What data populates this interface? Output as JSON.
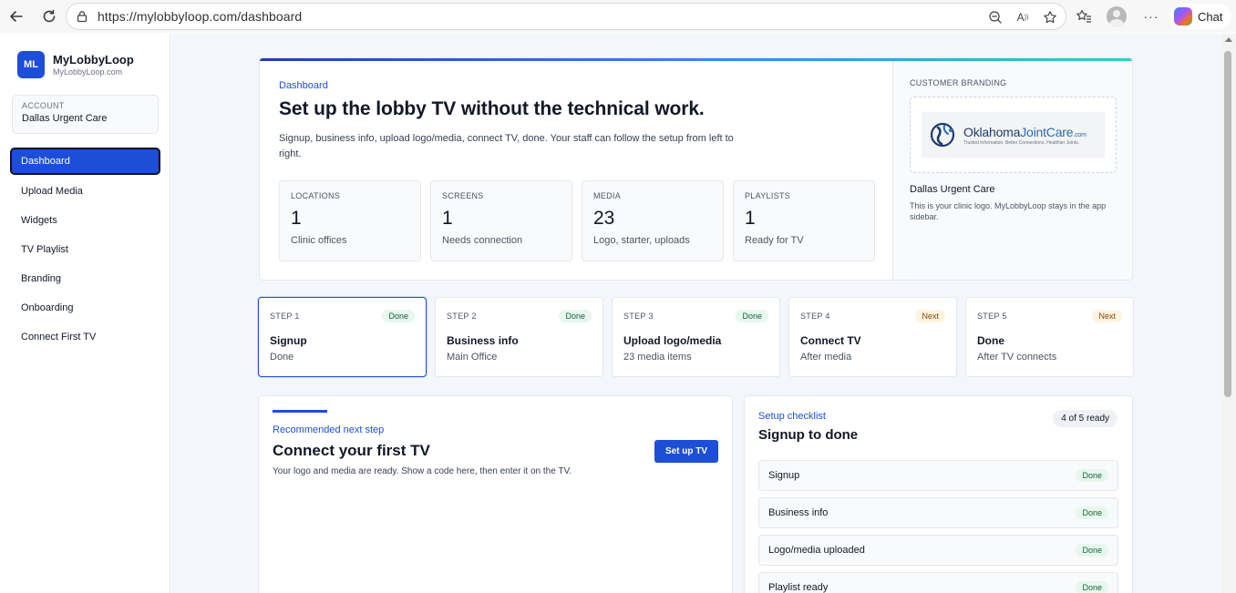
{
  "browser": {
    "url": "https://mylobbyloop.com/dashboard",
    "chat_label": "Chat"
  },
  "sidebar": {
    "badge": "ML",
    "brand_name": "MyLobbyLoop",
    "brand_sub": "MyLobbyLoop.com",
    "account_label": "ACCOUNT",
    "account_name": "Dallas Urgent Care",
    "items": [
      {
        "label": "Dashboard"
      },
      {
        "label": "Upload Media"
      },
      {
        "label": "Widgets"
      },
      {
        "label": "TV Playlist"
      },
      {
        "label": "Branding"
      },
      {
        "label": "Onboarding"
      },
      {
        "label": "Connect First TV"
      }
    ]
  },
  "hero": {
    "eyebrow": "Dashboard",
    "title": "Set up the lobby TV without the technical work.",
    "description": "Signup, business info, upload logo/media, connect TV, done. Your staff can follow the setup from left to right.",
    "stats": [
      {
        "label": "LOCATIONS",
        "value": "1",
        "sub": "Clinic offices"
      },
      {
        "label": "SCREENS",
        "value": "1",
        "sub": "Needs connection"
      },
      {
        "label": "MEDIA",
        "value": "23",
        "sub": "Logo, starter, uploads"
      },
      {
        "label": "PLAYLISTS",
        "value": "1",
        "sub": "Ready for TV"
      }
    ]
  },
  "branding": {
    "eyebrow": "CUSTOMER BRANDING",
    "logo_word1": "Oklahoma",
    "logo_word2": "JointCare",
    "logo_suffix": ".com",
    "logo_tagline": "Trusted Information. Better Connections. Healthier Joints.",
    "clinic": "Dallas Urgent Care",
    "note": "This is your clinic logo. MyLobbyLoop stays in the app sidebar."
  },
  "steps": [
    {
      "label": "STEP 1",
      "status": "Done",
      "title": "Signup",
      "sub": "Done"
    },
    {
      "label": "STEP 2",
      "status": "Done",
      "title": "Business info",
      "sub": "Main Office"
    },
    {
      "label": "STEP 3",
      "status": "Done",
      "title": "Upload logo/media",
      "sub": "23 media items"
    },
    {
      "label": "STEP 4",
      "status": "Next",
      "title": "Connect TV",
      "sub": "After media"
    },
    {
      "label": "STEP 5",
      "status": "Next",
      "title": "Done",
      "sub": "After TV connects"
    }
  ],
  "next_step": {
    "eyebrow": "Recommended next step",
    "title": "Connect your first TV",
    "description": "Your logo and media are ready. Show a code here, then enter it on the TV.",
    "button": "Set up TV"
  },
  "checklist": {
    "eyebrow": "Setup checklist",
    "title": "Signup to done",
    "count": "4 of 5 ready",
    "items": [
      {
        "name": "Signup",
        "status": "Done"
      },
      {
        "name": "Business info",
        "status": "Done"
      },
      {
        "name": "Logo/media uploaded",
        "status": "Done"
      },
      {
        "name": "Playlist ready",
        "status": "Done"
      }
    ]
  }
}
